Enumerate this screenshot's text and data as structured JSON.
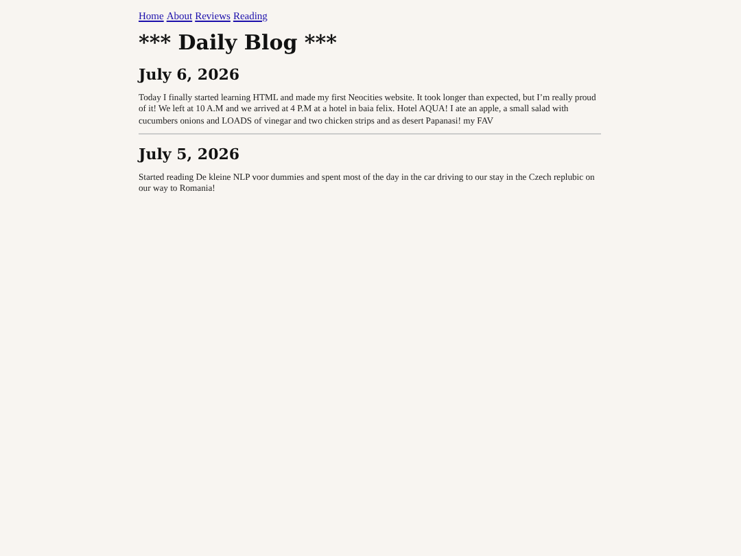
{
  "nav": [
    "Home",
    "About",
    "Reviews",
    "Reading"
  ],
  "title": "*** Daily Blog ***",
  "posts": [
    {
      "date": "July 6, 2026",
      "text": "Today I finally started learning HTML and made my first Neocities website. It took longer than expected, but I’m really proud of it! We left at 10 A.M and we arrived at 4 P.M at a hotel in baia felix. Hotel AQUA! I ate an apple, a small salad with cucumbers onions and LOADS of vinegar and two chicken strips and as desert Papanasi! my FAV"
    },
    {
      "date": "July 5, 2026",
      "text": "Started reading De kleine NLP voor dummies and spent most of the day in the car driving to our stay in the Czech replubic on our way to Romania!"
    }
  ]
}
